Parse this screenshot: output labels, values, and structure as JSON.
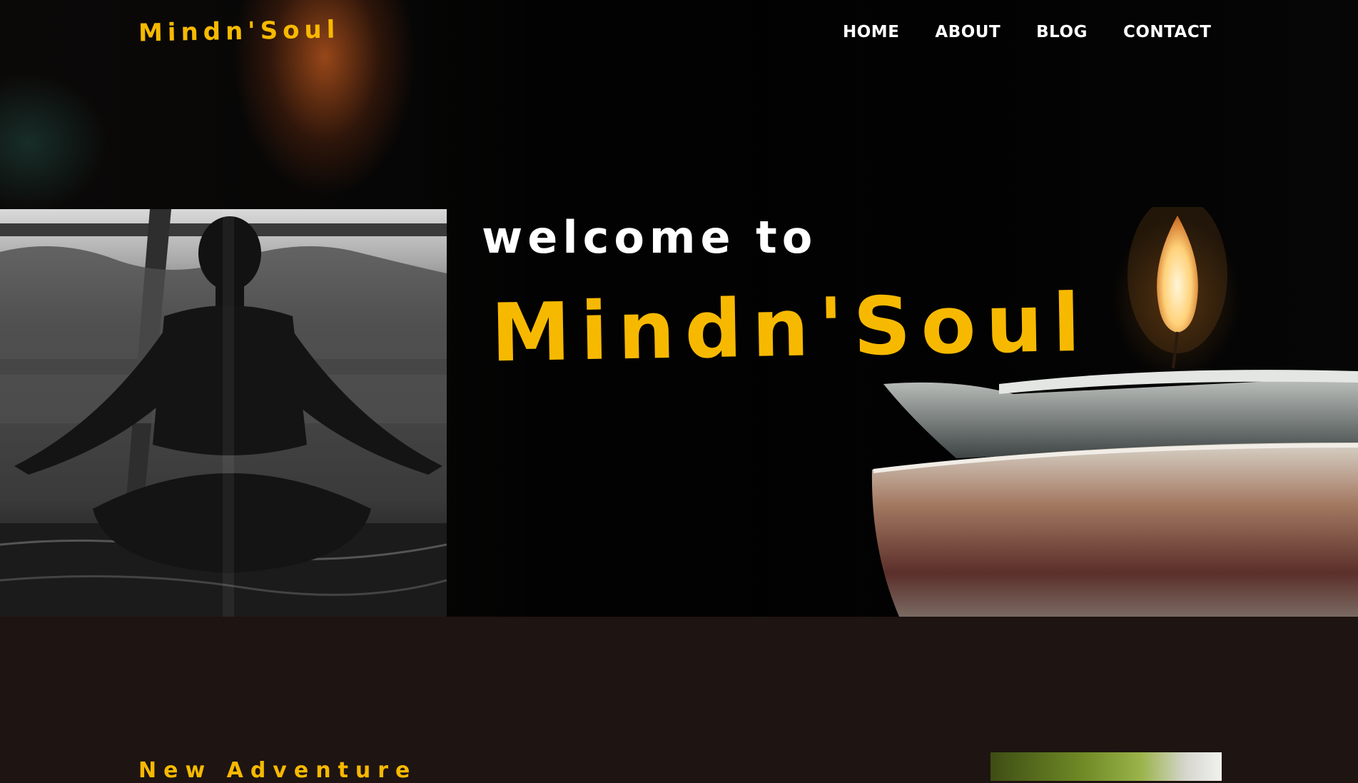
{
  "header": {
    "logo": "Mindn'Soul",
    "nav": [
      {
        "label": "HOME"
      },
      {
        "label": "ABOUT"
      },
      {
        "label": "BLOG"
      },
      {
        "label": "CONTACT"
      }
    ]
  },
  "hero": {
    "welcome": "welcome to",
    "brand": "Mindn'Soul"
  },
  "section": {
    "title": "New Adventure"
  },
  "colors": {
    "accent": "#f7b900",
    "background": "#1e1411"
  }
}
